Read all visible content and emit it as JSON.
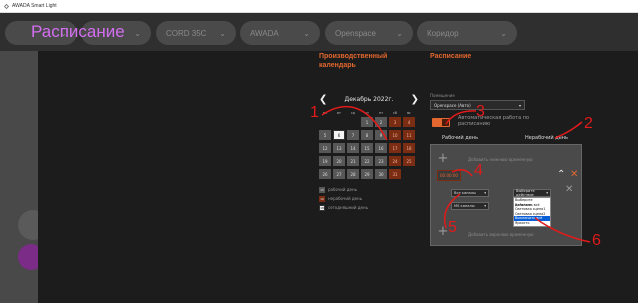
{
  "window": {
    "title": "AWADA Smart Light"
  },
  "header": {
    "page_title": "Расписание",
    "pills": [
      {
        "label": "",
        "has_chevron": true
      },
      {
        "label": "",
        "has_chevron": true
      },
      {
        "label": "CORD 35C",
        "has_chevron": true
      },
      {
        "label": "AWADA",
        "has_chevron": true
      },
      {
        "label": "Openspace",
        "has_chevron": true
      },
      {
        "label": "Коридор",
        "has_chevron": true
      }
    ]
  },
  "calendar": {
    "title_line1": "Производственный",
    "title_line2": "календарь",
    "month_label": "Декабрь 2022г.",
    "prev_icon": "chevron-left-icon",
    "next_icon": "chevron-right-icon",
    "weekdays": [
      "пн",
      "вт",
      "ср",
      "чт",
      "пт",
      "сб",
      "вс"
    ],
    "weeks": [
      [
        {
          "d": ""
        },
        {
          "d": ""
        },
        {
          "d": ""
        },
        {
          "d": "1"
        },
        {
          "d": "2"
        },
        {
          "d": "3",
          "off": true
        },
        {
          "d": "4",
          "off": true
        }
      ],
      [
        {
          "d": "5"
        },
        {
          "d": "6",
          "today": true
        },
        {
          "d": "7"
        },
        {
          "d": "8"
        },
        {
          "d": "9"
        },
        {
          "d": "10",
          "off": true
        },
        {
          "d": "11",
          "off": true
        }
      ],
      [
        {
          "d": "12"
        },
        {
          "d": "13"
        },
        {
          "d": "14"
        },
        {
          "d": "15"
        },
        {
          "d": "16"
        },
        {
          "d": "17",
          "off": true
        },
        {
          "d": "18",
          "off": true
        }
      ],
      [
        {
          "d": "19"
        },
        {
          "d": "20"
        },
        {
          "d": "21"
        },
        {
          "d": "22"
        },
        {
          "d": "23"
        },
        {
          "d": "24",
          "off": true
        },
        {
          "d": "25",
          "off": true
        }
      ],
      [
        {
          "d": "26"
        },
        {
          "d": "27"
        },
        {
          "d": "28"
        },
        {
          "d": "29"
        },
        {
          "d": "30"
        },
        {
          "d": "31",
          "off": true
        },
        {
          "d": ""
        }
      ]
    ],
    "legend": [
      {
        "swatch": "15",
        "label": "рабочий день",
        "kind": "work"
      },
      {
        "swatch": "16",
        "label": "нерабочий день",
        "kind": "off"
      },
      {
        "swatch": "18",
        "label": "сегодняшний день",
        "kind": "today"
      }
    ]
  },
  "schedule": {
    "title": "Расписание",
    "room_label": "Помещение",
    "room_value": "Openspace (Авто)",
    "auto_text": "Автоматическая работа по расписанию",
    "tab_work": "Рабочий день",
    "tab_off": "Нерабочий день",
    "add_time_hint": "Добавить нижнюю временную",
    "time_value": "00:00:00",
    "scene_select": "Все каналы",
    "channel_select": "MS каналы",
    "action_select": "Выберите действие",
    "action_options": [
      "Выберите действие",
      "Включить всё",
      "Световая сцена1",
      "Световая сцена2",
      "Выключить всё",
      "Яркость"
    ],
    "action_selected_index": 4,
    "add_interval_hint": "Добавить верхнюю временную"
  },
  "annotations": [
    "1",
    "2",
    "3",
    "4",
    "5",
    "6"
  ],
  "colors": {
    "accent": "#e3672e",
    "title_purple": "#d46ef1",
    "annotation_red": "#e21a1a"
  }
}
